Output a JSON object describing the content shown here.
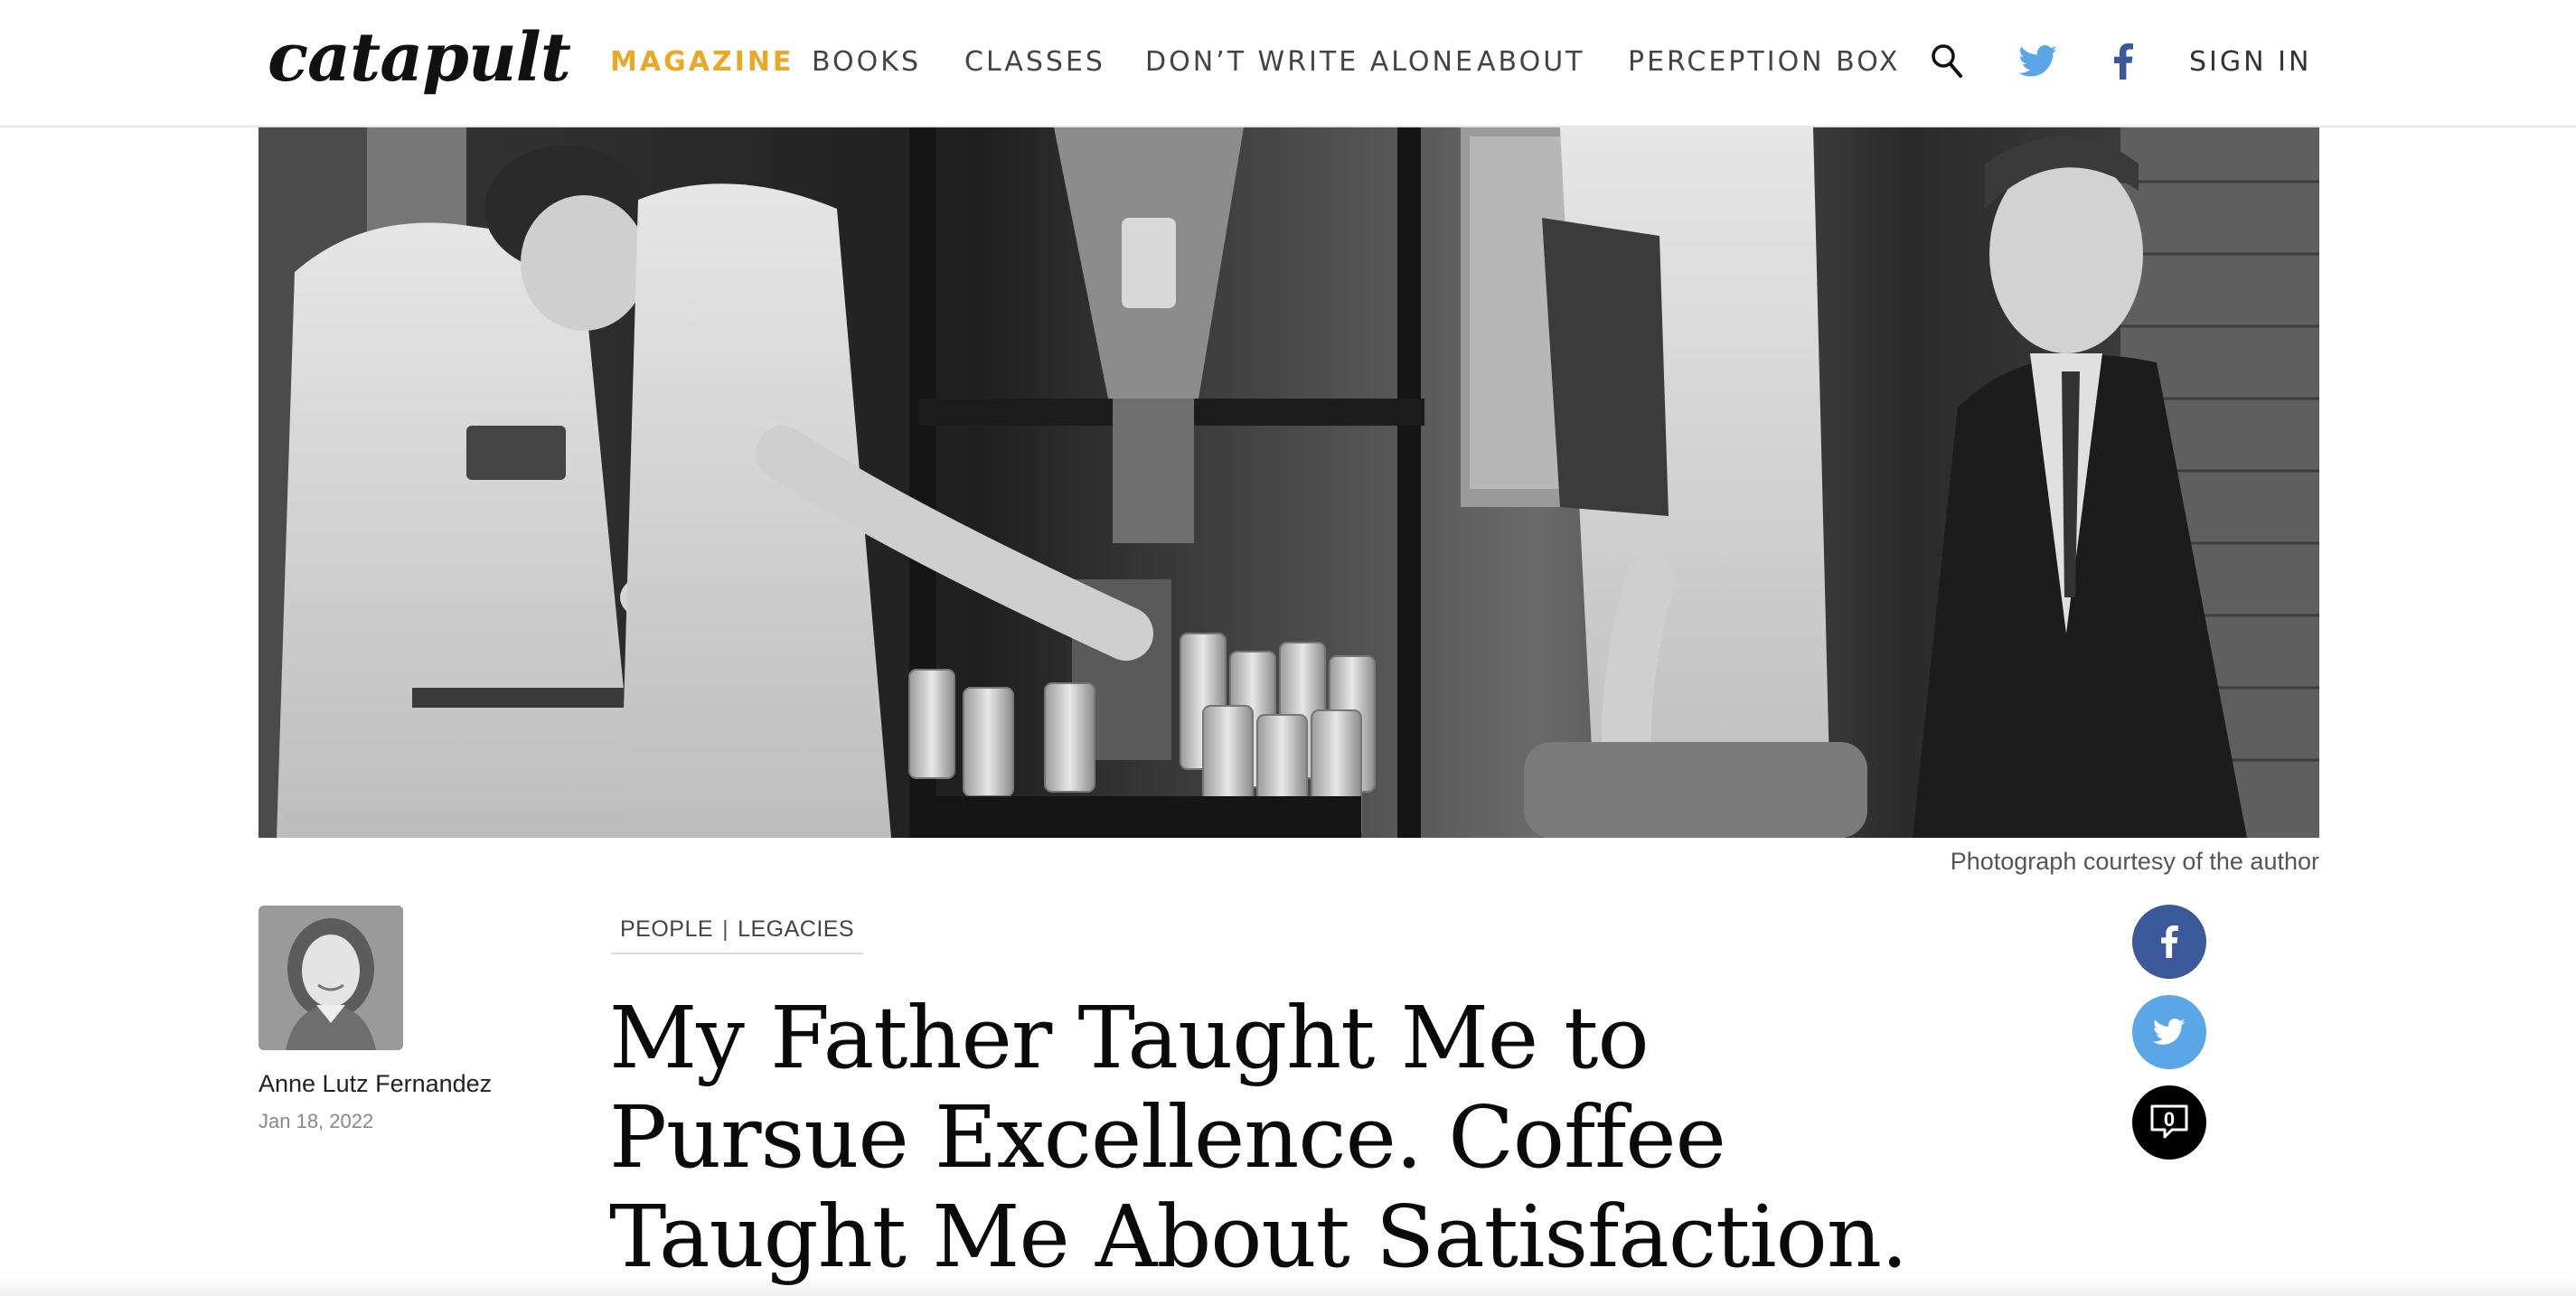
{
  "header": {
    "logo_text": "catapult",
    "nav": [
      {
        "label": "MAGAZINE",
        "active": true
      },
      {
        "label": "BOOKS",
        "active": false
      },
      {
        "label": "CLASSES",
        "active": false
      },
      {
        "label": "DON’T WRITE ALONE",
        "active": false
      },
      {
        "label": "ABOUT",
        "active": false
      },
      {
        "label": "PERCEPTION BOX",
        "active": false
      }
    ],
    "icons": [
      "search-icon",
      "twitter-icon",
      "facebook-icon"
    ],
    "sign_in_label": "SIGN IN"
  },
  "hero": {
    "caption": "Photograph courtesy of the author"
  },
  "author": {
    "name": "Anne Lutz Fernandez",
    "date": "Jan 18, 2022"
  },
  "article": {
    "tags": [
      "PEOPLE",
      "LEGACIES"
    ],
    "tag_separator": "|",
    "title": "My Father Taught Me to Pursue Excellence. Coffee Taught Me About Satisfaction."
  },
  "share": {
    "comment_count": "0",
    "icons": [
      "facebook-share-icon",
      "twitter-share-icon",
      "comment-icon"
    ]
  },
  "colors": {
    "accent": "#e8a928",
    "facebook": "#3b5998",
    "twitter": "#5aa6e6",
    "comment": "#000000"
  }
}
